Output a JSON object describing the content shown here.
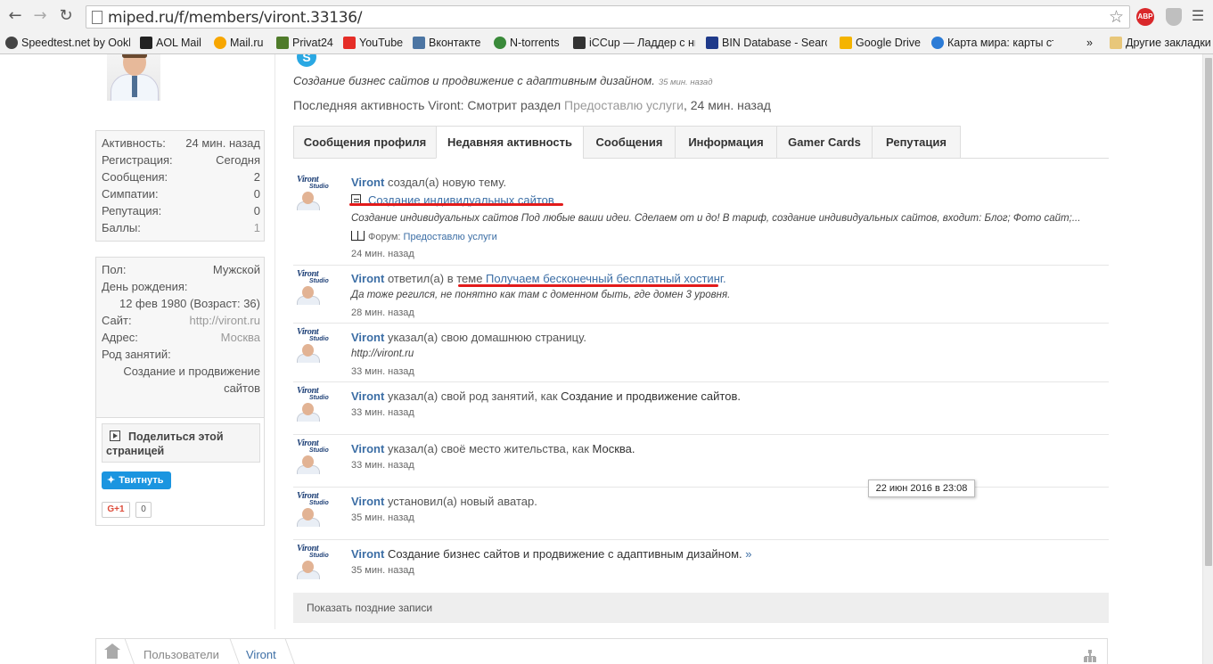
{
  "browser": {
    "url": "miped.ru/f/members/viront.33136/",
    "ext_abp": "ABP",
    "bookmarks": [
      {
        "label": "Speedtest.net by Ookla",
        "color": "#444"
      },
      {
        "label": "AOL Mail",
        "color": "#222"
      },
      {
        "label": "Mail.ru",
        "color": "#f7a600"
      },
      {
        "label": "Privat24",
        "color": "#4f7b2a"
      },
      {
        "label": "YouTube",
        "color": "#e52d27"
      },
      {
        "label": "Вконтакте",
        "color": "#4c75a3"
      },
      {
        "label": "N-torrents",
        "color": "#3a8a3a"
      },
      {
        "label": "iCCup — Ладдер с ни",
        "color": "#333"
      },
      {
        "label": "BIN Database - Search",
        "color": "#1f3a8a"
      },
      {
        "label": "Google Drive",
        "color": "#f4b400"
      },
      {
        "label": "Карта мира: карты ст",
        "color": "#2b7bd6"
      }
    ],
    "overflow": "»",
    "other_bookmarks": "Другие закладки"
  },
  "profile": {
    "stats": [
      {
        "k": "Активность:",
        "v": "24 мин. назад"
      },
      {
        "k": "Регистрация:",
        "v": "Сегодня"
      },
      {
        "k": "Сообщения:",
        "v": "2"
      },
      {
        "k": "Симпатии:",
        "v": "0"
      },
      {
        "k": "Репутация:",
        "v": "0"
      },
      {
        "k": "Баллы:",
        "v": "1"
      }
    ],
    "info": {
      "gender_k": "Пол:",
      "gender_v": "Мужской",
      "bday_k": "День рождения:",
      "bday_v": "12 фев 1980 (Возраст: 36)",
      "site_k": "Сайт:",
      "site_v": "http://viront.ru",
      "addr_k": "Адрес:",
      "addr_v": "Москва",
      "job_k": "Род занятий:",
      "job_v1": "Создание и продвижение",
      "job_v2": "сайтов"
    },
    "share": {
      "title1": "Поделиться этой",
      "title2": "страницей",
      "tweet": "Твитнуть",
      "gplus": "G+1",
      "gcount": "0"
    }
  },
  "main": {
    "status": "Создание бизнес сайтов и продвижение с адаптивным дизайном.",
    "status_time": "35 мин. назад",
    "lastact_prefix": "Последняя активность Viront:",
    "lastact_mid": "Смотрит раздел",
    "lastact_link": "Предоставлю услуги",
    "lastact_time": ", 24 мин. назад",
    "tabs": [
      "Сообщения профиля",
      "Недавняя активность",
      "Сообщения",
      "Информация",
      "Gamer Cards",
      "Репутация"
    ],
    "avatar_logo": "Viront",
    "avatar_logo2": "Studio",
    "user": "Viront",
    "feed": {
      "i1_action": " создал(а) новую тему.",
      "i1_title": "Создание индивидуальных сайтов",
      "i1_snippet": "Создание индивидуальных сайтов Под любые ваши идеи. Сделаем от и до! В тариф, создание индивидуальных сайтов, входит: Блог; Фото сайт;...",
      "i1_forum_k": "Форум:",
      "i1_forum_v": "Предоставлю услуги",
      "i1_time": "24 мин. назад",
      "i2_action": " ответил(а) в теме ",
      "i2_title": "Получаем бесконечный бесплатный хостинг",
      "i2_dot": ".",
      "i2_snippet": "Да тоже регился, не понятно как там с доменном быть, где домен 3 уровня.",
      "i2_time": "28 мин. назад",
      "i3_action": " указал(а) свою домашнюю страницу.",
      "i3_link": "http://viront.ru",
      "i3_time": "33 мин. назад",
      "i4_action": " указал(а) свой род занятий, как ",
      "i4_value": "Создание и продвижение сайтов.",
      "i4_time": "33 мин. назад",
      "i5_action": " указал(а) своё место жительства, как ",
      "i5_value": "Москва.",
      "i5_time": "33 мин. назад",
      "i6_action": " установил(а) новый аватар.",
      "i6_time": "35 мин. назад",
      "i7_action": " Создание бизнес сайтов и продвижение с адаптивным дизайном.",
      "i7_more": " »",
      "i7_time": "35 мин. назад"
    },
    "tooltip": "22 июн 2016 в 23:08",
    "show_more": "Показать поздние записи"
  },
  "breadcrumb": {
    "users": "Пользователи",
    "current": "Viront"
  }
}
